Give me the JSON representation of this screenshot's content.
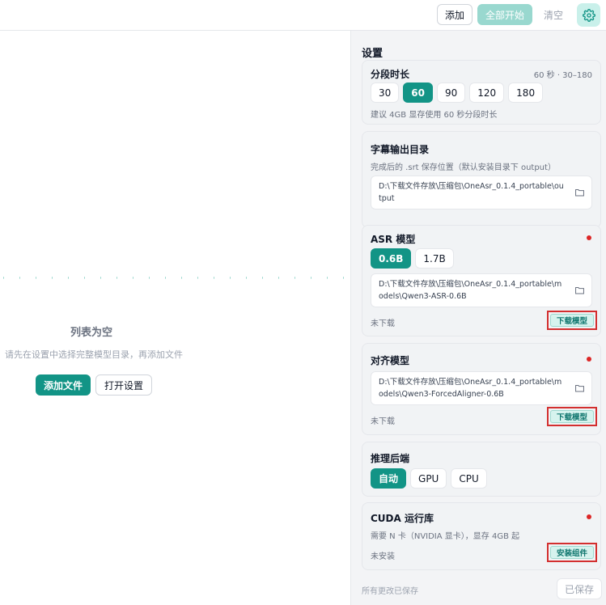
{
  "toolbar": {
    "add_label": "添加",
    "start_all_label": "全部开始",
    "clear_label": "清空",
    "settings_icon": "gear-icon",
    "accent_color": "#129486"
  },
  "empty_state": {
    "title": "列表为空",
    "description": "请先在设置中选择完整模型目录，再添加文件",
    "add_files_label": "添加文件",
    "open_settings_label": "打开设置"
  },
  "settings": {
    "title": "设置",
    "segment": {
      "title": "分段时长",
      "meta": "60 秒 · 30–180",
      "options": [
        "30",
        "60",
        "90",
        "120",
        "180"
      ],
      "selected": "60",
      "hint": "建议 4GB 显存使用 60 秒分段时长"
    },
    "subtitle_output": {
      "title": "字幕输出目录",
      "hint": "完成后的 .srt 保存位置（默认安装目录下 output）",
      "path": "D:\\下载文件存放\\压缩包\\OneAsr_0.1.4_portable\\output"
    },
    "asr_model": {
      "title": "ASR 模型",
      "options": [
        "0.6B",
        "1.7B"
      ],
      "selected": "0.6B",
      "path": "D:\\下载文件存放\\压缩包\\OneAsr_0.1.4_portable\\models\\Qwen3-ASR-0.6B",
      "status": "未下载",
      "action_label": "下载模型"
    },
    "align_model": {
      "title": "对齐模型",
      "path": "D:\\下载文件存放\\压缩包\\OneAsr_0.1.4_portable\\models\\Qwen3-ForcedAligner-0.6B",
      "status": "未下载",
      "action_label": "下载模型"
    },
    "backend": {
      "title": "推理后端",
      "options": [
        "自动",
        "GPU",
        "CPU"
      ],
      "selected": "自动"
    },
    "cuda": {
      "title": "CUDA 运行库",
      "hint": "需要 N 卡（NVIDIA 显卡），显存 4GB 起",
      "status": "未安装",
      "action_label": "安装组件"
    },
    "footer": {
      "status": "所有更改已保存",
      "save_label": "已保存"
    }
  }
}
